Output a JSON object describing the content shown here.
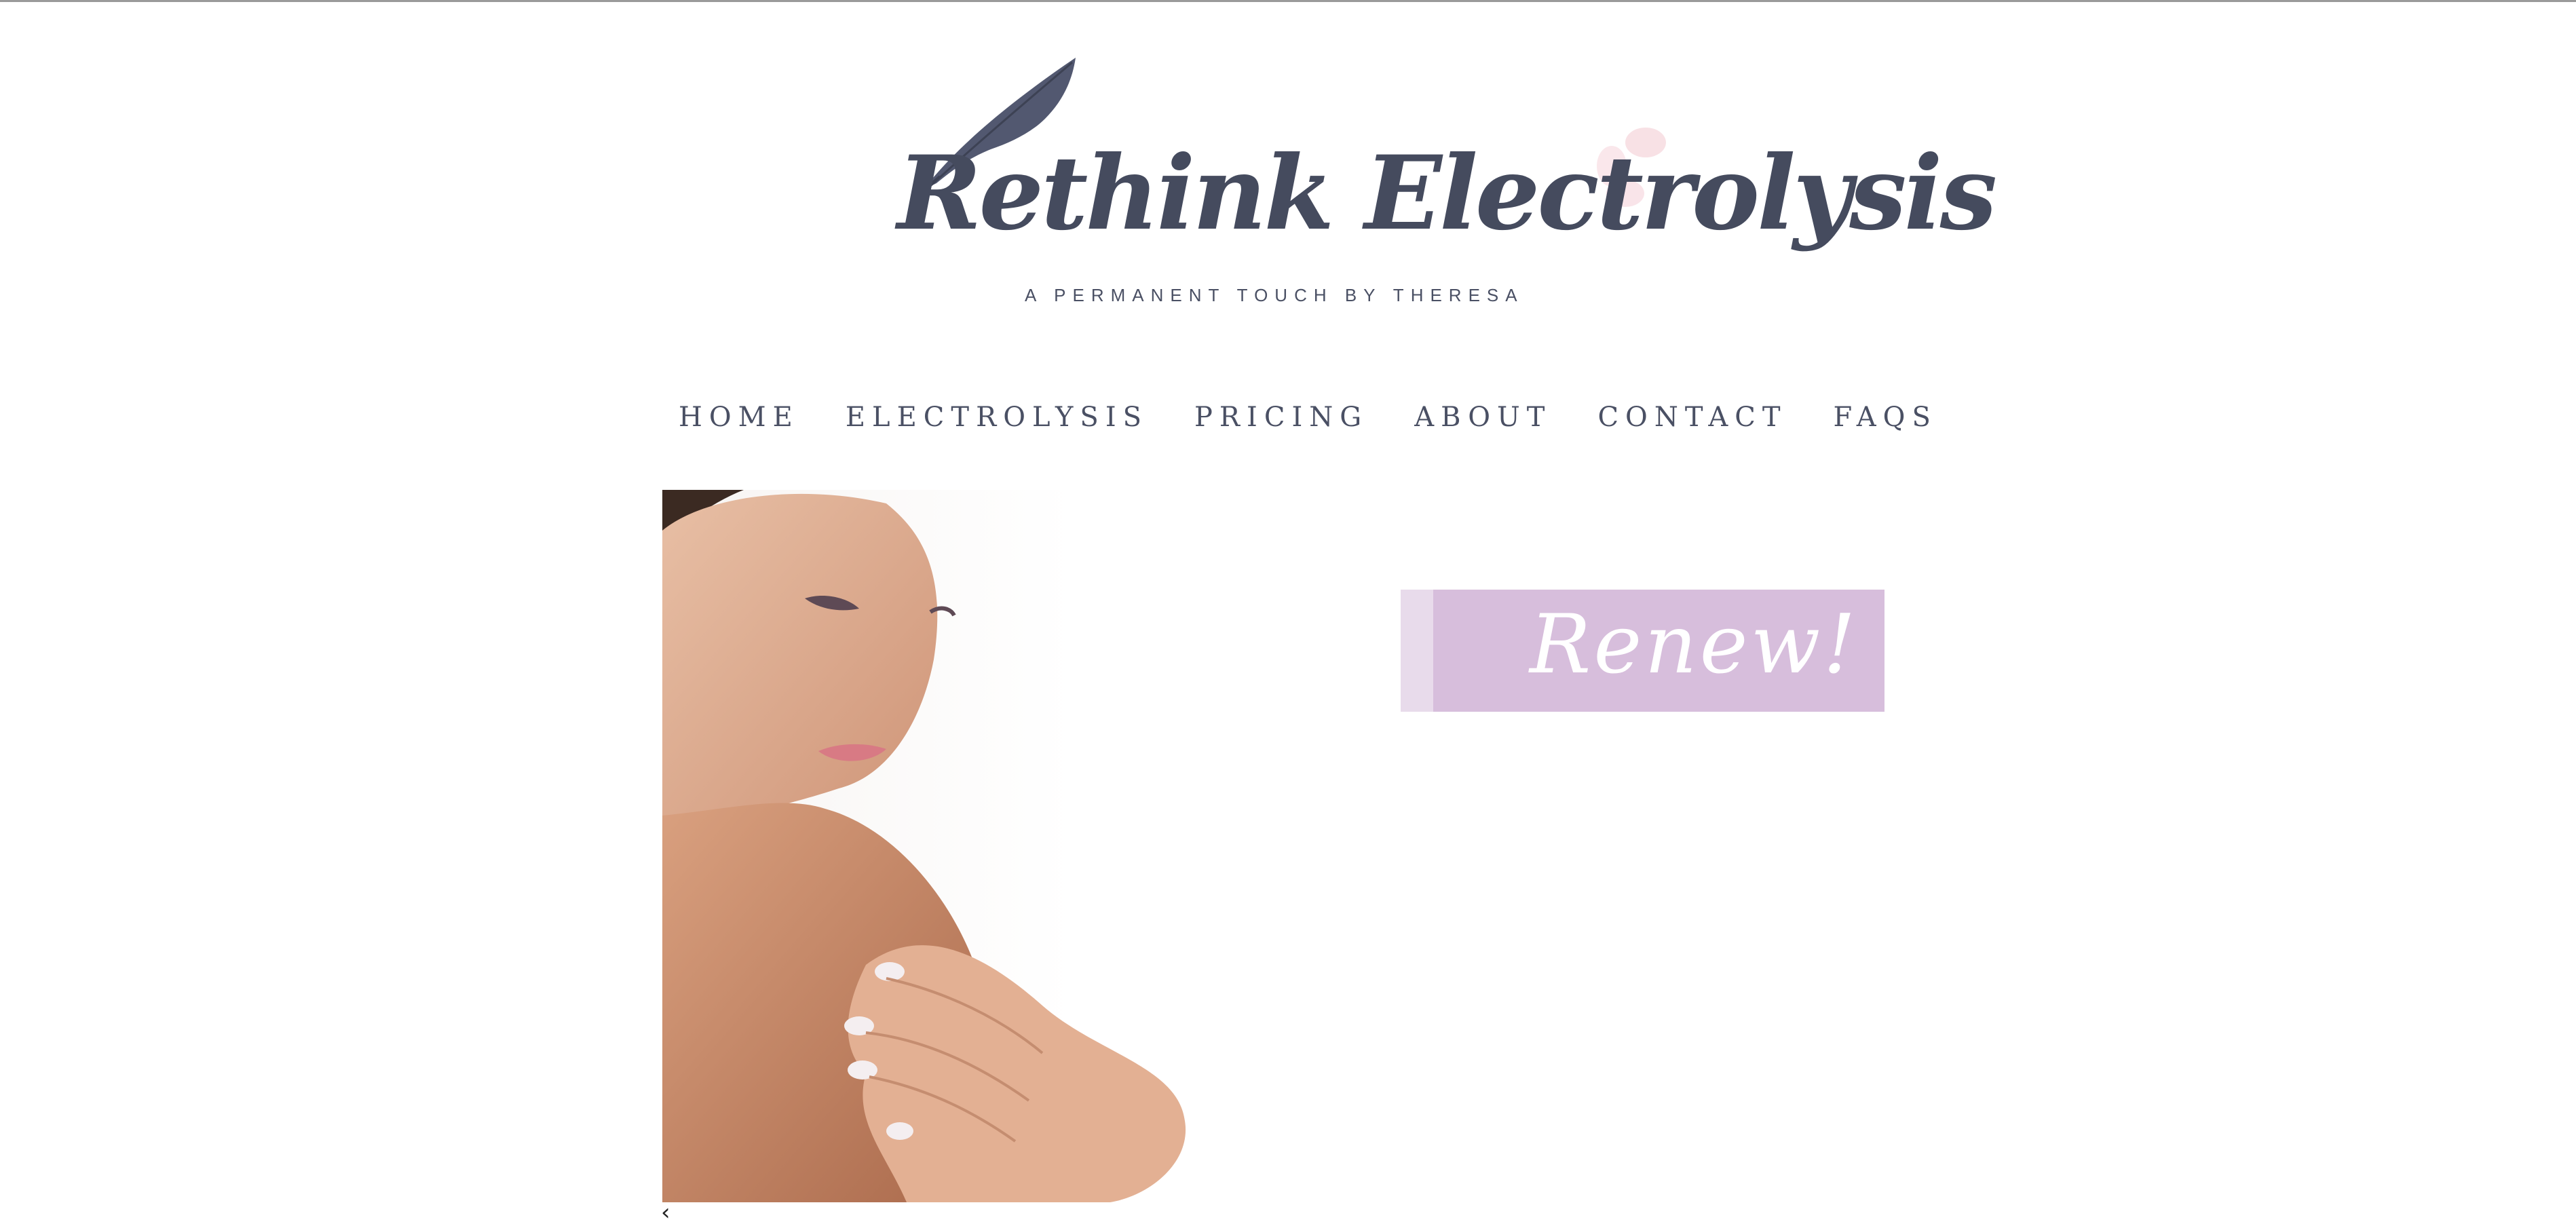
{
  "logo": {
    "title": "Rethink Electrolysis",
    "tagline": "A PERMANENT TOUCH BY THERESA"
  },
  "nav": {
    "items": [
      {
        "label": "HOME"
      },
      {
        "label": "ELECTROLYSIS"
      },
      {
        "label": "PRICING"
      },
      {
        "label": "ABOUT"
      },
      {
        "label": "CONTACT"
      },
      {
        "label": "FAQS"
      }
    ]
  },
  "banner": {
    "text": "Renew!"
  },
  "carousel": {
    "prev_label": "‹"
  },
  "colors": {
    "brand_text": "#454b5e",
    "banner_bg": "#d7bedc",
    "banner_stripe": "#e8dbeb"
  },
  "icons": {
    "logo_ornament": "feather-icon",
    "petal_ornament": "petals-icon"
  }
}
